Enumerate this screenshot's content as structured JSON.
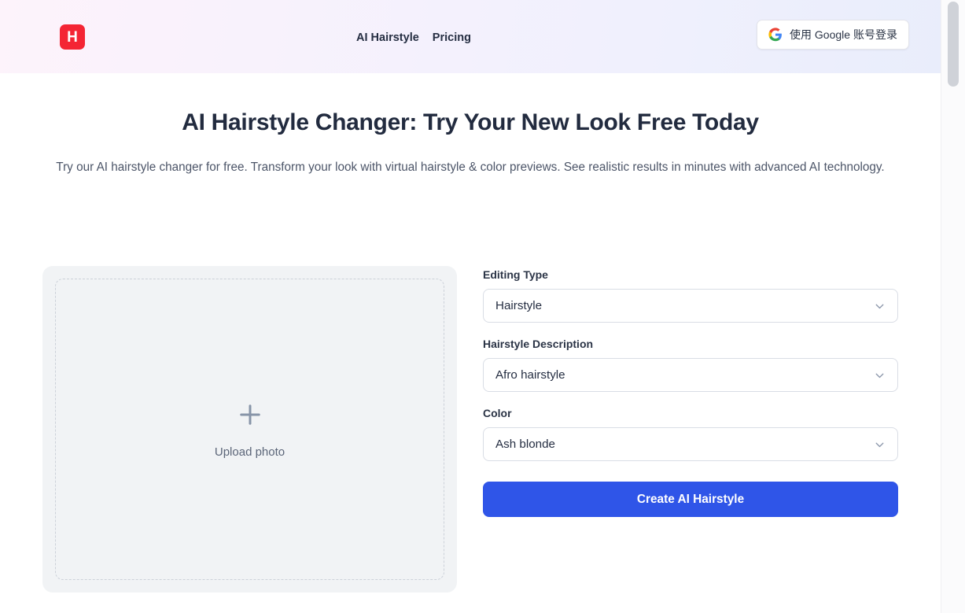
{
  "header": {
    "logo_letter": "H",
    "logo_color": "#f42534",
    "nav": [
      {
        "label": "AI Hairstyle",
        "name": "nav-link-ai-hairstyle"
      },
      {
        "label": "Pricing",
        "name": "nav-link-pricing"
      }
    ],
    "google_login_label": "使用 Google 账号登录",
    "icons": {
      "google": "google-g-icon"
    }
  },
  "hero": {
    "title": "AI Hairstyle Changer: Try Your New Look Free Today",
    "subtitle": "Try our AI hairstyle changer for free. Transform your look with virtual hairstyle & color previews. See realistic results in minutes with advanced AI technology."
  },
  "upload": {
    "label": "Upload photo",
    "icon": "plus-icon"
  },
  "form": {
    "fields": [
      {
        "label": "Editing Type",
        "value": "Hairstyle",
        "name": "editing-type",
        "icon": "chevron-down-icon"
      },
      {
        "label": "Hairstyle Description",
        "value": "Afro hairstyle",
        "name": "hairstyle-description",
        "icon": "chevron-down-icon"
      },
      {
        "label": "Color",
        "value": "Ash blonde",
        "name": "color",
        "icon": "chevron-down-icon"
      }
    ],
    "submit_label": "Create AI Hairstyle",
    "accent_color": "#2f55e8"
  }
}
